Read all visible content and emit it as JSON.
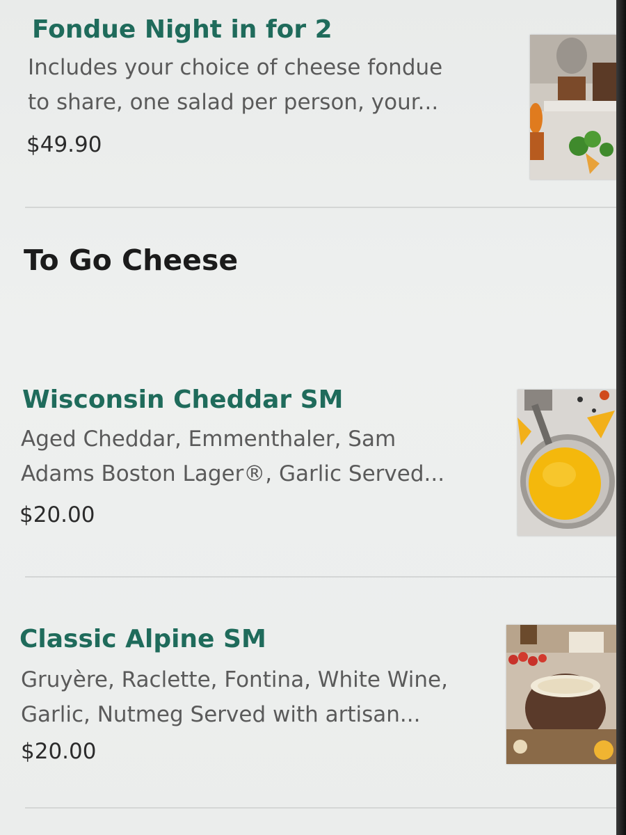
{
  "menu_items": [
    {
      "name": "Fondue Night in for 2",
      "description_lines": [
        "Includes your choice of cheese fondue",
        "to share, one salad per person, your..."
      ],
      "price": "$49.90",
      "image": "fondue-night-photo"
    },
    {
      "name": "Wisconsin Cheddar SM",
      "description_lines": [
        "Aged Cheddar, Emmenthaler, Sam",
        "Adams Boston Lager®, Garlic Served..."
      ],
      "price": "$20.00",
      "image": "cheddar-fondue-photo"
    },
    {
      "name": "Classic Alpine SM",
      "description_lines": [
        "Gruyère, Raclette, Fontina, White Wine,",
        "Garlic, Nutmeg Served with artisan..."
      ],
      "price": "$20.00",
      "image": "alpine-fondue-photo"
    }
  ],
  "section": {
    "title": "To Go Cheese"
  },
  "colors": {
    "item_name": "#1f6b5b",
    "description": "#5a5a5a",
    "price": "#2b2b2b",
    "section_title": "#1b1b1b"
  }
}
